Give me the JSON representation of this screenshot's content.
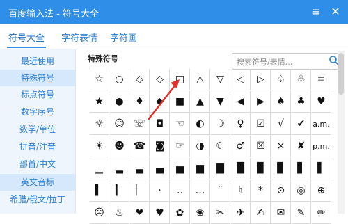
{
  "window": {
    "title": "百度输入法 - 符号大全",
    "menu_glyph": "≡",
    "close_glyph": "✕"
  },
  "tabs": [
    {
      "label": "符号大全",
      "active": true
    },
    {
      "label": "字符表情",
      "active": false
    },
    {
      "label": "字符画",
      "active": false
    }
  ],
  "search": {
    "placeholder": "搜索符号/表情..."
  },
  "sidebar": {
    "items": [
      {
        "label": "最近使用",
        "selected": false
      },
      {
        "label": "特殊符号",
        "selected": true
      },
      {
        "label": "标点符号",
        "selected": false
      },
      {
        "label": "数字序号",
        "selected": false
      },
      {
        "label": "数学/单位",
        "selected": false
      },
      {
        "label": "拼音/注音",
        "selected": false
      },
      {
        "label": "部首/中文",
        "selected": false
      },
      {
        "label": "英文音标",
        "selected": true
      },
      {
        "label": "希腊/俄文/拉丁",
        "selected": false
      }
    ]
  },
  "main": {
    "category_title": "特殊符号",
    "symbols": [
      [
        "☆",
        "○",
        "◇",
        "◇",
        "□",
        "△",
        "▽",
        "◁",
        "▷",
        "♤",
        "♧",
        "≡"
      ],
      [
        "★",
        "●",
        "♦",
        "◆",
        "■",
        "▲",
        "▼",
        "◀",
        "▶",
        "♠",
        "♣",
        "♥"
      ],
      [
        "☼",
        "☺",
        "☏",
        "◘",
        "☜",
        "◐",
        "☽",
        "♀",
        "☑",
        "√",
        "✔",
        "a.m."
      ],
      [
        "☀",
        "☻",
        "☎",
        "◙",
        "☞",
        "◑",
        "☾",
        "♂",
        "☒",
        "×",
        "✘",
        "p.m."
      ],
      [
        "▁",
        "▂",
        "▃",
        "▄",
        "▅",
        "▆",
        "▇",
        "█",
        "▉",
        "▊",
        "▋",
        "▌"
      ],
      [
        "▍",
        "▎",
        "▏",
        "·",
        "‥",
        "…",
        "¨",
        "♮",
        "*",
        "⊙",
        "◎",
        "⊕"
      ],
      [
        "☹",
        "♨",
        "❤",
        "♥",
        "✿",
        "❀",
        "✂",
        "✈",
        "✍",
        "✉",
        "✎",
        "✏"
      ]
    ]
  },
  "colors": {
    "titlebar": "#2e8ee8",
    "accent": "#2a7fd5",
    "sidebar_bg": "#eef5fc",
    "sidebar_selected": "#d6e8fb",
    "arrow": "#e0302a"
  }
}
